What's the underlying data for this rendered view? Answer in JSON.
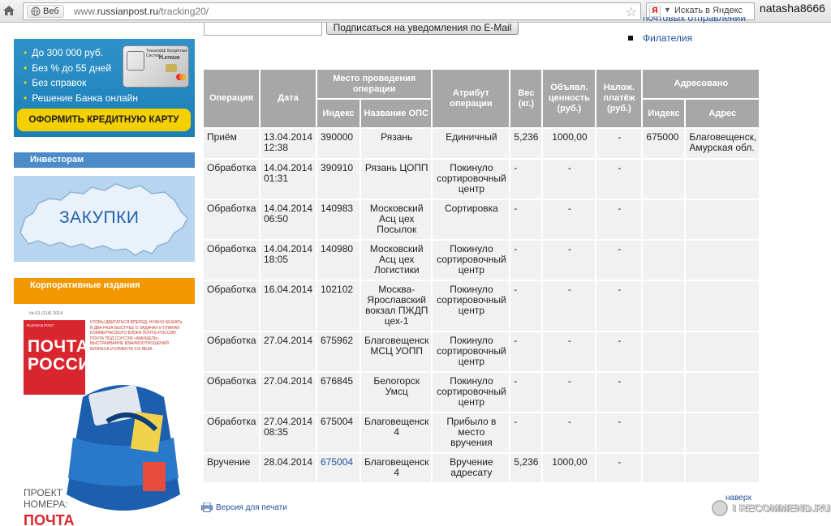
{
  "browser": {
    "web_chip": "Веб",
    "url_prefix": "www.",
    "url_domain": "russianpost.ru",
    "url_path": "/tracking20/",
    "search_placeholder": "Искать в Яндекс",
    "search_engine_glyph": "Я",
    "user_name": "natasha8666"
  },
  "sidebar": {
    "credit_banner": {
      "items": [
        "До 300 000 руб.",
        "Без % до 55 дней",
        "Без справок",
        "Решение Банка онлайн"
      ],
      "card_title": "Тинькофф Кредитные Системы",
      "card_platinum": "PLATINUM",
      "button": "ОФОРМИТЬ КРЕДИТНУЮ КАРТУ"
    },
    "investors_header": "Инвесторам",
    "zakupki_label": "ЗАКУПКИ",
    "corporate_header": "Корпоративные издания",
    "journal": {
      "issue": "№ 01 (114) 2014",
      "red_sub": "RUSSIAN POST",
      "title_line1": "ПОЧТА",
      "title_line2": "РОССИИ",
      "lines": "ЧТОБЫ ДВИГАТЬСЯ ВПЕРЕД, НУЖНО БЕЖАТЬ В ДВА РАЗА БЫСТРЕЕ О ЗАДАЧАХ И ПЛАНАХ КОММЕРЧЕСКОГО БЛОКА ПОЧТЫ РОССИИ ПОЧТА ПОД СОУСОМ «АМИШЕЛЬ» ВЫСТРАИВАНИЕ ВЗАИМООТНОШЕНИЙ БИЗНЕСА И КЛИЕНТА XXI ВЕКА",
      "project_line1": "ПРОЕКТ",
      "project_line2": "НОМЕРА:",
      "project_title": "ПОЧТА"
    }
  },
  "top": {
    "subscribe_button": "Подписаться на уведомления по E-Mail",
    "clipped_link": "почтовых отправлений",
    "link_philately": "Филателия"
  },
  "table": {
    "headers": {
      "operation": "Операция",
      "date": "Дата",
      "place": "Место проведения операции",
      "place_index": "Индекс",
      "place_name": "Название ОПС",
      "attribute": "Атрибут операции",
      "weight": "Вес (кг.)",
      "declared_value": "Объявл. ценность (руб.)",
      "cod": "Налож. платёж (руб.)",
      "addressed": "Адресовано",
      "addr_index": "Индекс",
      "addr": "Адрес"
    },
    "rows": [
      {
        "op": "Приём",
        "date": "13.04.2014 12:38",
        "idx": "390000",
        "name": "Рязань",
        "attr": "Единичный",
        "weight": "5,236",
        "value": "1000,00",
        "cod": "-",
        "to_idx": "675000",
        "to_addr": "Благовещенск, Амурская обл."
      },
      {
        "op": "Обработка",
        "date": "14.04.2014 01:31",
        "idx": "390910",
        "name": "Рязань ЦОПП",
        "attr": "Покинуло сортировочный центр",
        "weight": "-",
        "value": "-",
        "cod": "-",
        "to_idx": "",
        "to_addr": ""
      },
      {
        "op": "Обработка",
        "date": "14.04.2014 06:50",
        "idx": "140983",
        "name": "Московский Асц цех Посылок",
        "attr": "Сортировка",
        "weight": "-",
        "value": "-",
        "cod": "-",
        "to_idx": "",
        "to_addr": ""
      },
      {
        "op": "Обработка",
        "date": "14.04.2014 18:05",
        "idx": "140980",
        "name": "Московский Асц цех Логистики",
        "attr": "Покинуло сортировочный центр",
        "weight": "-",
        "value": "-",
        "cod": "-",
        "to_idx": "",
        "to_addr": ""
      },
      {
        "op": "Обработка",
        "date": "16.04.2014",
        "idx": "102102",
        "name": "Москва-Ярославский вокзал ПЖДП цех-1",
        "attr": "Покинуло сортировочный центр",
        "weight": "-",
        "value": "-",
        "cod": "-",
        "to_idx": "",
        "to_addr": ""
      },
      {
        "op": "Обработка",
        "date": "27.04.2014",
        "idx": "675962",
        "name": "Благовещенск МСЦ УОПП",
        "attr": "Покинуло сортировочный центр",
        "weight": "-",
        "value": "-",
        "cod": "-",
        "to_idx": "",
        "to_addr": ""
      },
      {
        "op": "Обработка",
        "date": "27.04.2014",
        "idx": "676845",
        "name": "Белогорск Умсц",
        "attr": "Покинуло сортировочный центр",
        "weight": "-",
        "value": "-",
        "cod": "-",
        "to_idx": "",
        "to_addr": ""
      },
      {
        "op": "Обработка",
        "date": "27.04.2014 08:35",
        "idx": "675004",
        "name": "Благовещенск 4",
        "attr": "Прибыло в место вручения",
        "weight": "-",
        "value": "-",
        "cod": "-",
        "to_idx": "",
        "to_addr": ""
      },
      {
        "op": "Вручение",
        "date": "28.04.2014",
        "idx": "675004",
        "name": "Благовещенск 4",
        "attr": "Вручение адресату",
        "weight": "5,236",
        "value": "1000,00",
        "cod": "-",
        "to_idx": "",
        "to_addr": "",
        "idx_is_link": true
      }
    ]
  },
  "footer": {
    "print_link": "Версия для печати",
    "back_to_top": "наверх",
    "watermark": "I RECOMMEND.RU"
  }
}
